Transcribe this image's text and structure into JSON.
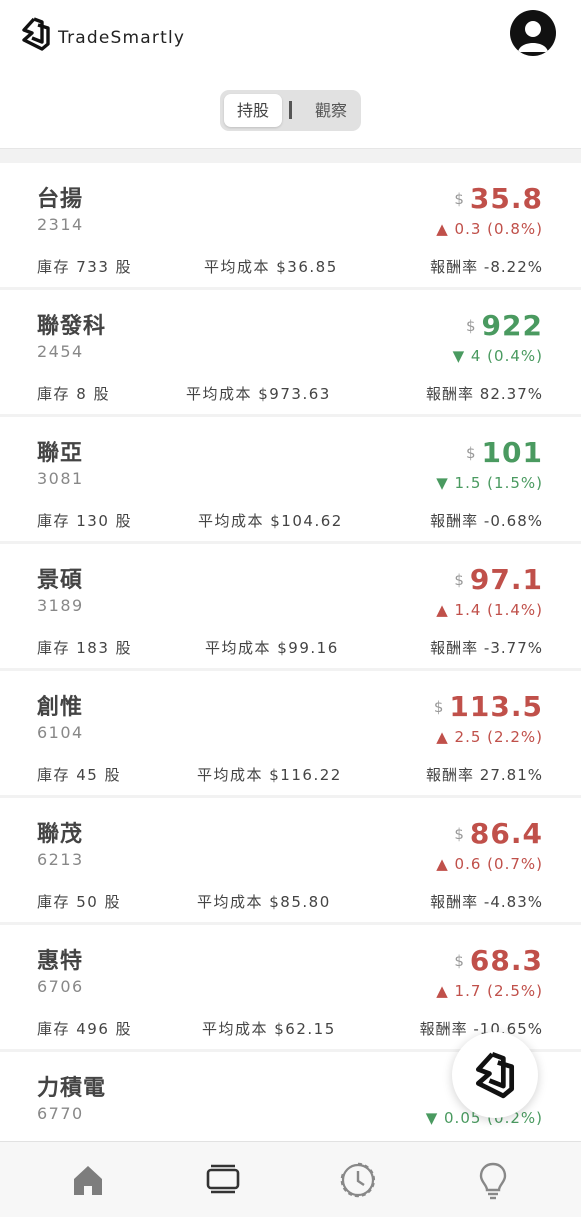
{
  "app": {
    "name": "TradeSmartly"
  },
  "tabs": [
    {
      "label": "持股",
      "active": true
    },
    {
      "label": "觀察",
      "active": false
    }
  ],
  "colors": {
    "up": "#c0504a",
    "down": "#4a9a60"
  },
  "labels": {
    "currency": "$"
  },
  "holdings": [
    {
      "name": "台揚",
      "code": "2314",
      "price": "35.8",
      "direction": "up",
      "change": "▲ 0.3 (0.8%)",
      "stock": "庫存 733 股",
      "avg_cost": "平均成本 $36.85",
      "return": "報酬率 -8.22%"
    },
    {
      "name": "聯發科",
      "code": "2454",
      "price": "922",
      "direction": "down",
      "change": "▼ 4 (0.4%)",
      "stock": "庫存 8 股",
      "avg_cost": "平均成本 $973.63",
      "return": "報酬率 82.37%"
    },
    {
      "name": "聯亞",
      "code": "3081",
      "price": "101",
      "direction": "down",
      "change": "▼ 1.5 (1.5%)",
      "stock": "庫存 130 股",
      "avg_cost": "平均成本 $104.62",
      "return": "報酬率 -0.68%"
    },
    {
      "name": "景碩",
      "code": "3189",
      "price": "97.1",
      "direction": "up",
      "change": "▲ 1.4 (1.4%)",
      "stock": "庫存 183 股",
      "avg_cost": "平均成本 $99.16",
      "return": "報酬率 -3.77%"
    },
    {
      "name": "創惟",
      "code": "6104",
      "price": "113.5",
      "direction": "up",
      "change": "▲ 2.5 (2.2%)",
      "stock": "庫存 45 股",
      "avg_cost": "平均成本 $116.22",
      "return": "報酬率 27.81%"
    },
    {
      "name": "聯茂",
      "code": "6213",
      "price": "86.4",
      "direction": "up",
      "change": "▲ 0.6 (0.7%)",
      "stock": "庫存 50 股",
      "avg_cost": "平均成本 $85.80",
      "return": "報酬率 -4.83%"
    },
    {
      "name": "惠特",
      "code": "6706",
      "price": "68.3",
      "direction": "up",
      "change": "▲ 1.7 (2.5%)",
      "stock": "庫存 496 股",
      "avg_cost": "平均成本 $62.15",
      "return": "報酬率 -10.65%"
    },
    {
      "name": "力積電",
      "code": "6770",
      "price": "",
      "direction": "down",
      "change": "▼ 0.05 (0.2%)",
      "stock": "",
      "avg_cost": "",
      "return": ""
    }
  ],
  "bottom_nav": [
    {
      "icon": "home-icon"
    },
    {
      "icon": "portfolio-icon"
    },
    {
      "icon": "history-icon"
    },
    {
      "icon": "lightbulb-icon"
    }
  ]
}
